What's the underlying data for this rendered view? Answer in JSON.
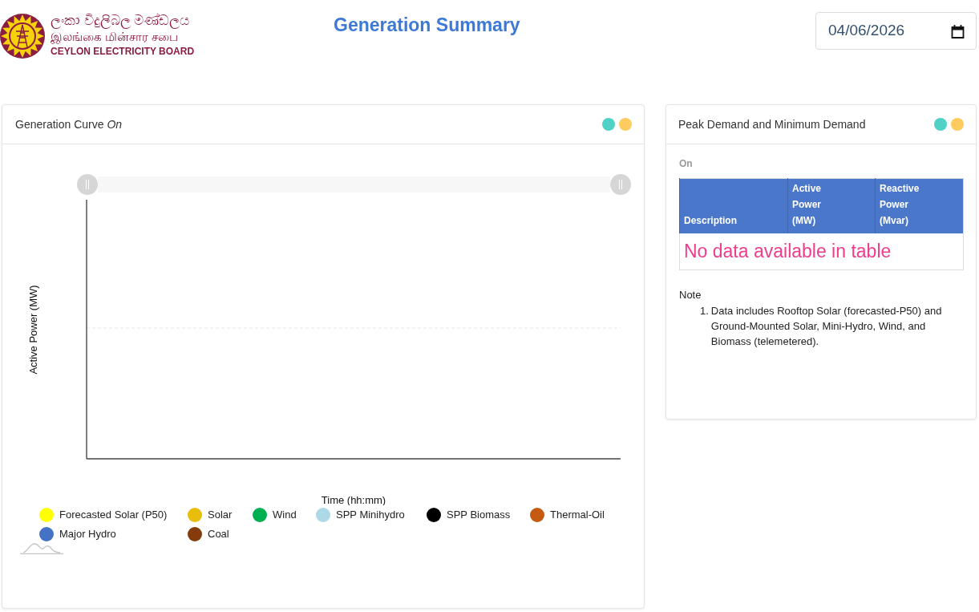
{
  "header": {
    "logo": {
      "line_1": "ලංකා විදුලිබල මණ්ඩලය",
      "line_2": "இலங்கை மின்சார சபை",
      "line_3": "CEYLON ELECTRICITY BOARD"
    },
    "title": "Generation Summary",
    "date_field": {
      "value": "04/06/2026"
    }
  },
  "generation_curve": {
    "title": "Generation Curve *On*",
    "chart": {
      "xlabel": "Time (hh:mm)",
      "ylabel": "Active Power (MW)",
      "legend": [
        {
          "name": "Forecasted Solar (P50)",
          "color": "#ffff00"
        },
        {
          "name": "Solar",
          "color": "#e8bd0c"
        },
        {
          "name": "Wind",
          "color": "#00b050"
        },
        {
          "name": "SPP Minihydro",
          "color": "#add8e6"
        },
        {
          "name": "SPP Biomass",
          "color": "#000000"
        },
        {
          "name": "Thermal-Oil",
          "color": "#c55a11"
        },
        {
          "name": "Major Hydro",
          "color": "#4472c4"
        },
        {
          "name": "Coal",
          "color": "#843c0c"
        }
      ]
    }
  },
  "peak_demand": {
    "title": "Peak Demand and Minimum Demand",
    "subtitle": "On",
    "table": {
      "columns": [
        "Description",
        "Active Power (MW)",
        "Reactive Power (Mvar)"
      ],
      "empty_message": "No data available in table"
    },
    "note": {
      "label": "Note",
      "items": [
        {
          "number": "1.",
          "text": "Data includes Rooftop Solar (forecasted-P50) and Ground-Mounted Solar, Mini-Hydro, Wind, and Biomass (telemetered)."
        }
      ]
    }
  }
}
